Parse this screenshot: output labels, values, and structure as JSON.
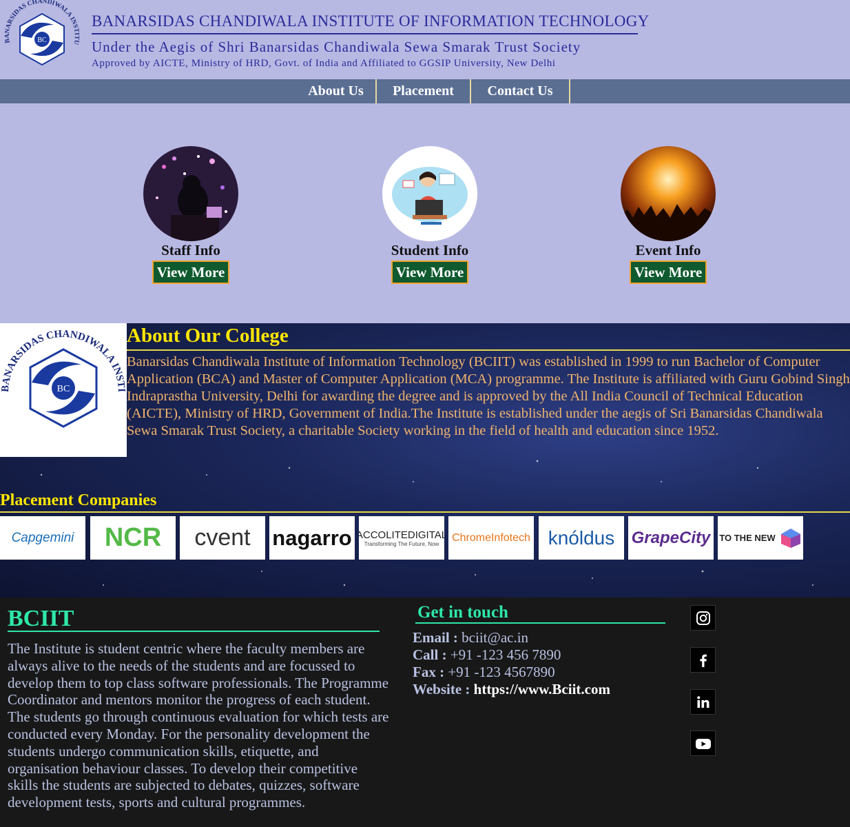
{
  "header": {
    "logo_text": "BANARSIDAS CHANDIWALA INSTITUTE OF INFORMATION TECHNOLOGY",
    "logo_initials": "BC",
    "title": "BANARSIDAS CHANDIWALA INSTITUTE OF INFORMATION TECHNOLOGY",
    "subtitle": "Under the Aegis of Shri Banarsidas Chandiwala Sewa Smarak Trust Society",
    "approved": "Approved by AICTE, Ministry of HRD, Govt. of India and Affiliated to GGSIP University, New Delhi"
  },
  "nav": {
    "items": [
      {
        "label": "About Us"
      },
      {
        "label": "Placement"
      },
      {
        "label": "Contact Us"
      }
    ]
  },
  "cards": [
    {
      "label": "Staff Info",
      "button": "View More"
    },
    {
      "label": "Student Info",
      "button": "View More"
    },
    {
      "label": "Event Info",
      "button": "View More"
    }
  ],
  "about": {
    "title": "About Our College",
    "text": "Banarsidas Chandiwala Institute of Information Technology (BCIIT) was established in 1999 to run Bachelor of Computer Application (BCA) and Master of Computer Application (MCA) programme. The Institute is affiliated with Guru Gobind Singh Indraprastha University, Delhi for awarding the degree and is approved by the All India Council of Technical Education (AICTE), Ministry of HRD, Government of India.The Institute is established under the aegis of Sri Banarsidas Chandiwala Sewa Smarak Trust Society, a charitable Society working in the field of health and education since 1952."
  },
  "placement": {
    "title": "Placement Companies",
    "companies": [
      {
        "name": "Capgemini",
        "color": "#1d6fb8"
      },
      {
        "name": "NCR",
        "color": "#54b948"
      },
      {
        "name": "cvent",
        "color": "#333333"
      },
      {
        "name": "nagarro",
        "color": "#111111"
      },
      {
        "name": "ACCOLITEDIGITAL",
        "tagline": "Transforming The Future, Now",
        "color": "#222222"
      },
      {
        "name": "ChromeInfotech",
        "color": "#e8751a"
      },
      {
        "name": "knóldus",
        "color": "#1b5aa8"
      },
      {
        "name": "GrapeCity",
        "color": "#5b2d8e"
      },
      {
        "name": "TO THE NEW",
        "color": "#222222"
      }
    ]
  },
  "footer": {
    "title": "BCIIT",
    "description": "The Institute is student centric where the faculty members are always alive to the needs of the students and are focussed to develop them to top class software professionals. The Programme Coordinator and mentors monitor the progress of each student. The students go through continuous evaluation for which tests are conducted every Monday. For the personality development the students undergo communication skills, etiquette, and organisation behaviour classes. To develop their competitive skills the students are subjected to debates, quizzes, software development tests, sports and cultural programmes.",
    "touch_title": "Get in touch",
    "email_label": "Email :",
    "email": "bciit@ac.in",
    "call_label": "Call :",
    "call": "+91 -123 456 7890",
    "fax_label": "Fax :",
    "fax": "+91 -123 4567890",
    "website_label": "Website :",
    "website": "https://www.Bciit.com",
    "social": [
      {
        "icon": "instagram-icon"
      },
      {
        "icon": "facebook-icon"
      },
      {
        "icon": "linkedin-icon"
      },
      {
        "icon": "youtube-icon"
      }
    ]
  },
  "colors": {
    "page_bg": "#b8b9e3",
    "nav_bg": "#5a6e92",
    "accent_yellow": "#ffe600",
    "footer_accent": "#2ee8a7",
    "button_bg": "#0f5a2e"
  }
}
